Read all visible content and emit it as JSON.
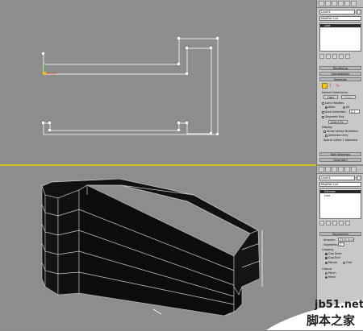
{
  "top_panel": {
    "object_name": "Line01",
    "modifier_list": "Modifier List",
    "stack_item": "Line",
    "rollouts": {
      "rendering": "Rendering",
      "interpolation": "Interpolation",
      "selection": "Selection",
      "soft_selection": "Soft Selection",
      "geometry": "Geometry"
    },
    "selection": {
      "named_selections": "Named Selections:",
      "copy": "Copy",
      "paste": "Paste",
      "lock_handles": "Lock Handles",
      "alike": "Alike",
      "all": "All",
      "area_selection": "Area Selection:",
      "area_value": "0.1",
      "segment_end": "Segment End",
      "select_by": "Select By...",
      "display": "Display",
      "show_vertex_numbers": "Show Vertex Numbers",
      "selected_only": "Selected Only",
      "status": "Spline 1/Vert 1 Selected"
    }
  },
  "bottom_panel": {
    "object_name": "Line01",
    "modifier_list": "Modifier List",
    "stack_items": [
      "Extrude",
      "Line"
    ],
    "parameters": {
      "title": "Parameters",
      "amount_label": "Amount:",
      "amount_value": "2500.0mm",
      "segments_label": "Segments:",
      "segments_value": "1",
      "capping": "Capping",
      "cap_start": "Cap Start",
      "cap_end": "Cap End",
      "morph": "Morph",
      "grid": "Grid",
      "output": "Output",
      "patch": "Patch",
      "mesh": "Mesh"
    }
  },
  "watermark": {
    "site": "jb51.net",
    "name": "脚本之家"
  }
}
